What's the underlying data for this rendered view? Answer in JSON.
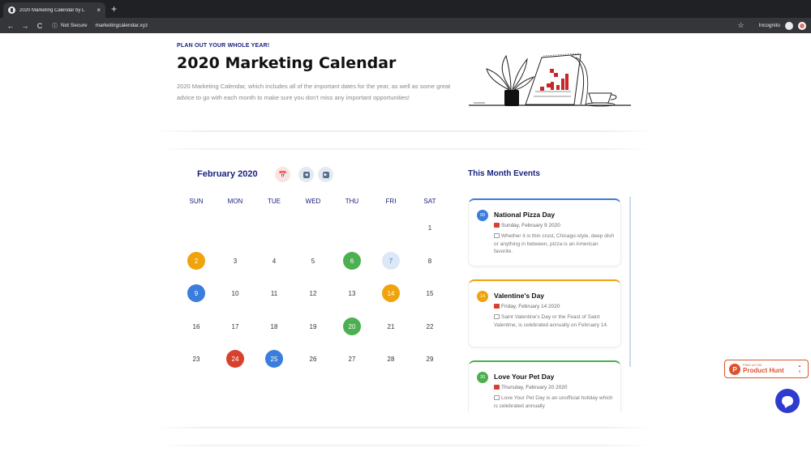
{
  "browser": {
    "tab_title": "2020 Marketing Calendar by L",
    "tab_close": "×",
    "new_tab": "+",
    "back": "←",
    "forward": "→",
    "reload": "C",
    "security_icon": "ⓘ",
    "security_text": "Not Secure",
    "url": "marketingcalendar.xyz",
    "bookmark": "☆",
    "mode_label": "Incognito"
  },
  "hero": {
    "eyebrow": "PLAN OUT YOUR WHOLE YEAR!",
    "title": "2020 Marketing Calendar",
    "description": "2020 Marketing Calendar, which includes all of the important dates for the year, as well as some great advice to go with each month to make sure you don't miss any important opportunities!"
  },
  "calendar": {
    "month_label": "February 2020",
    "today_icon": "📅",
    "prev_icon": "◀",
    "next_icon": "▶",
    "weekdays": [
      "SUN",
      "MON",
      "TUE",
      "WED",
      "THU",
      "FRI",
      "SAT"
    ],
    "days": [
      {
        "label": "1",
        "style": "plain"
      },
      {
        "label": "2",
        "style": "orange"
      },
      {
        "label": "3",
        "style": "plain"
      },
      {
        "label": "4",
        "style": "plain"
      },
      {
        "label": "5",
        "style": "plain"
      },
      {
        "label": "6",
        "style": "green"
      },
      {
        "label": "7",
        "style": "light"
      },
      {
        "label": "8",
        "style": "plain"
      },
      {
        "label": "9",
        "style": "blue"
      },
      {
        "label": "10",
        "style": "plain"
      },
      {
        "label": "11",
        "style": "plain"
      },
      {
        "label": "12",
        "style": "plain"
      },
      {
        "label": "13",
        "style": "plain"
      },
      {
        "label": "14",
        "style": "orange"
      },
      {
        "label": "15",
        "style": "plain"
      },
      {
        "label": "16",
        "style": "plain"
      },
      {
        "label": "17",
        "style": "plain"
      },
      {
        "label": "18",
        "style": "plain"
      },
      {
        "label": "19",
        "style": "plain"
      },
      {
        "label": "20",
        "style": "green"
      },
      {
        "label": "21",
        "style": "plain"
      },
      {
        "label": "22",
        "style": "plain"
      },
      {
        "label": "23",
        "style": "plain"
      },
      {
        "label": "24",
        "style": "red"
      },
      {
        "label": "25",
        "style": "blue"
      },
      {
        "label": "26",
        "style": "plain"
      },
      {
        "label": "27",
        "style": "plain"
      },
      {
        "label": "28",
        "style": "plain"
      },
      {
        "label": "29",
        "style": "plain"
      }
    ]
  },
  "events": {
    "title": "This Month Events",
    "items": [
      {
        "badge": "09",
        "color": "blue",
        "name": "National Pizza Day",
        "date": "Sunday, February 9 2020",
        "note": "Whether it is thin crust, Chicago-style, deep dish or anything in between, pizza is an American favorite."
      },
      {
        "badge": "14",
        "color": "orange",
        "name": "Valentine's Day",
        "date": "Friday, February 14 2020",
        "note": "Saint Valentine's Day or the Feast of Saint Valentine, is celebrated annually on February 14."
      },
      {
        "badge": "20",
        "color": "green",
        "name": "Love Your Pet Day",
        "date": "Thursday, February 20 2020",
        "note": "Love Your Pet Day is an unofficial holiday which is celebrated annually"
      }
    ]
  },
  "product_hunt": {
    "logo_letter": "P",
    "small_label": "FIND US ON",
    "label": "Product Hunt",
    "vote_arrow": "▲",
    "vote_count": "5"
  },
  "colors": {
    "navy": "#1a237e",
    "orange": "#f0a30a",
    "green": "#4caf50",
    "blue": "#3b7ddd",
    "red": "#d9412f",
    "product_hunt": "#da552f",
    "chat": "#2f3bcf"
  }
}
